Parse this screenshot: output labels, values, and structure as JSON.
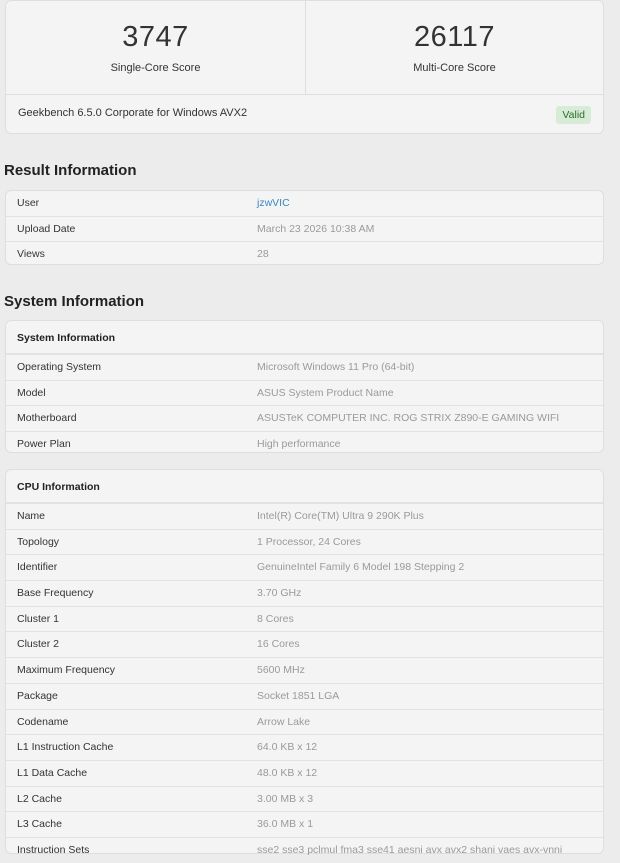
{
  "scores": {
    "single": {
      "value": "3747",
      "label": "Single-Core Score"
    },
    "multi": {
      "value": "26117",
      "label": "Multi-Core Score"
    },
    "version": "Geekbench 6.5.0 Corporate for Windows AVX2",
    "status": "Valid"
  },
  "result_info": {
    "title": "Result Information",
    "rows": [
      {
        "key": "User",
        "value": "jzwVIC"
      },
      {
        "key": "Upload Date",
        "value": "March 23 2026 10:38 AM"
      },
      {
        "key": "Views",
        "value": "28"
      }
    ]
  },
  "system_info": {
    "title": "System Information",
    "system": {
      "heading": "System Information",
      "rows": [
        {
          "key": "Operating System",
          "value": "Microsoft Windows 11 Pro (64-bit)"
        },
        {
          "key": "Model",
          "value": "ASUS System Product Name"
        },
        {
          "key": "Motherboard",
          "value": "ASUSTeK COMPUTER INC. ROG STRIX Z890-E GAMING WIFI"
        },
        {
          "key": "Power Plan",
          "value": "High performance"
        }
      ]
    },
    "cpu": {
      "heading": "CPU Information",
      "rows": [
        {
          "key": "Name",
          "value": "Intel(R) Core(TM) Ultra 9 290K Plus"
        },
        {
          "key": "Topology",
          "value": "1 Processor, 24 Cores"
        },
        {
          "key": "Identifier",
          "value": "GenuineIntel Family 6 Model 198 Stepping 2"
        },
        {
          "key": "Base Frequency",
          "value": "3.70 GHz"
        },
        {
          "key": "Cluster 1",
          "value": "8 Cores"
        },
        {
          "key": "Cluster 2",
          "value": "16 Cores"
        },
        {
          "key": "Maximum Frequency",
          "value": "5600 MHz"
        },
        {
          "key": "Package",
          "value": "Socket 1851 LGA"
        },
        {
          "key": "Codename",
          "value": "Arrow Lake"
        },
        {
          "key": "L1 Instruction Cache",
          "value": "64.0 KB x 12"
        },
        {
          "key": "L1 Data Cache",
          "value": "48.0 KB x 12"
        },
        {
          "key": "L2 Cache",
          "value": "3.00 MB x 3"
        },
        {
          "key": "L3 Cache",
          "value": "36.0 MB x 1"
        },
        {
          "key": "Instruction Sets",
          "value": "sse2 sse3 pclmul fma3 sse41 aesni avx avx2 shani vaes avx-vnni"
        }
      ]
    }
  }
}
